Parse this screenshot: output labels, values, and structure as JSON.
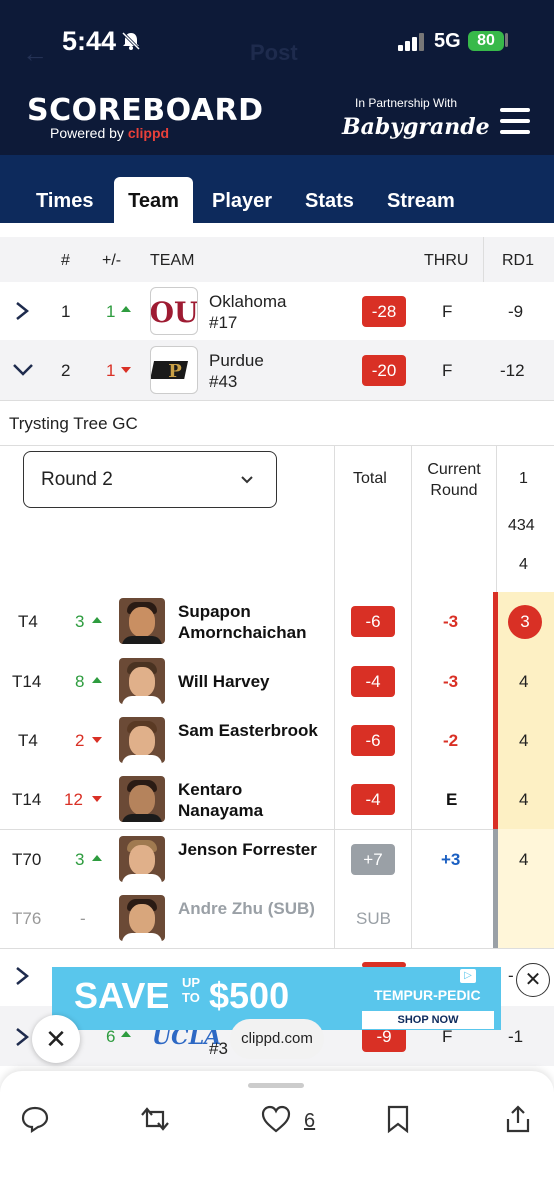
{
  "status_bar": {
    "time": "5:44",
    "network": "5G",
    "battery": "80"
  },
  "background_nav": {
    "title": "Post"
  },
  "header": {
    "brand": "SCOREBOARD",
    "powered_prefix": "Powered by",
    "powered_name": "clippd",
    "partner_text": "In Partnership With",
    "partner_name": "Babygrande"
  },
  "tabs": [
    "Times",
    "Team",
    "Player",
    "Stats",
    "Stream"
  ],
  "table": {
    "headers": {
      "pos": "#",
      "change": "+/-",
      "team": "TEAM",
      "thru": "THRU",
      "rd1": "RD1"
    },
    "rows": [
      {
        "pos": "1",
        "change": "1",
        "name": "Oklahoma",
        "rank": "#17",
        "score": "-28",
        "thru": "F",
        "rd1": "-9"
      },
      {
        "pos": "2",
        "change": "1",
        "name": "Purdue",
        "rank": "#43",
        "score": "-20",
        "thru": "F",
        "rd1": "-12"
      }
    ],
    "partial_rows": [
      {
        "score": "",
        "rd1": "-"
      },
      {
        "change": "6",
        "name": "UCLA",
        "rank": "#3",
        "score": "-9",
        "thru": "F",
        "rd1": "-1"
      }
    ]
  },
  "course": "Trysting Tree GC",
  "round_select": {
    "selected": "Round 2"
  },
  "player_table": {
    "headers": {
      "total": "Total",
      "current_round": "Current Round",
      "hole": "1",
      "yards": "434",
      "par": "4"
    },
    "players": [
      {
        "pos": "T4",
        "change": "3",
        "dir": "up",
        "name": "Supapon Amornchaichan",
        "total": "-6",
        "current": "-3",
        "hole1": "3"
      },
      {
        "pos": "T14",
        "change": "8",
        "dir": "up",
        "name": "Will Harvey",
        "total": "-4",
        "current": "-3",
        "hole1": "4"
      },
      {
        "pos": "T4",
        "change": "2",
        "dir": "down",
        "name": "Sam Easterbrook",
        "total": "-6",
        "current": "-2",
        "hole1": "4"
      },
      {
        "pos": "T14",
        "change": "12",
        "dir": "down",
        "name": "Kentaro Nanayama",
        "total": "-4",
        "current": "E",
        "hole1": "4"
      },
      {
        "pos": "T70",
        "change": "3",
        "dir": "up",
        "name": "Jenson Forrester",
        "total": "+7",
        "current": "+3",
        "hole1": "4"
      },
      {
        "pos": "T76",
        "change": "-",
        "dir": "none",
        "name": "Andre Zhu (SUB)",
        "total": "SUB",
        "current": "",
        "hole1": ""
      }
    ]
  },
  "ad": {
    "headline_1": "SAVE",
    "headline_up": "UP",
    "headline_to": "TO",
    "headline_2": "$500",
    "brand": "TEMPUR-PEDIC",
    "cta": "SHOP NOW"
  },
  "url_chip": "clippd.com",
  "actions": {
    "likes": "6"
  },
  "colors": {
    "navy": "#0d1a38",
    "tab_blue": "#0d2a5c",
    "red": "#d93025",
    "green": "#2e9c3f",
    "highlight": "#fdf0c4"
  }
}
